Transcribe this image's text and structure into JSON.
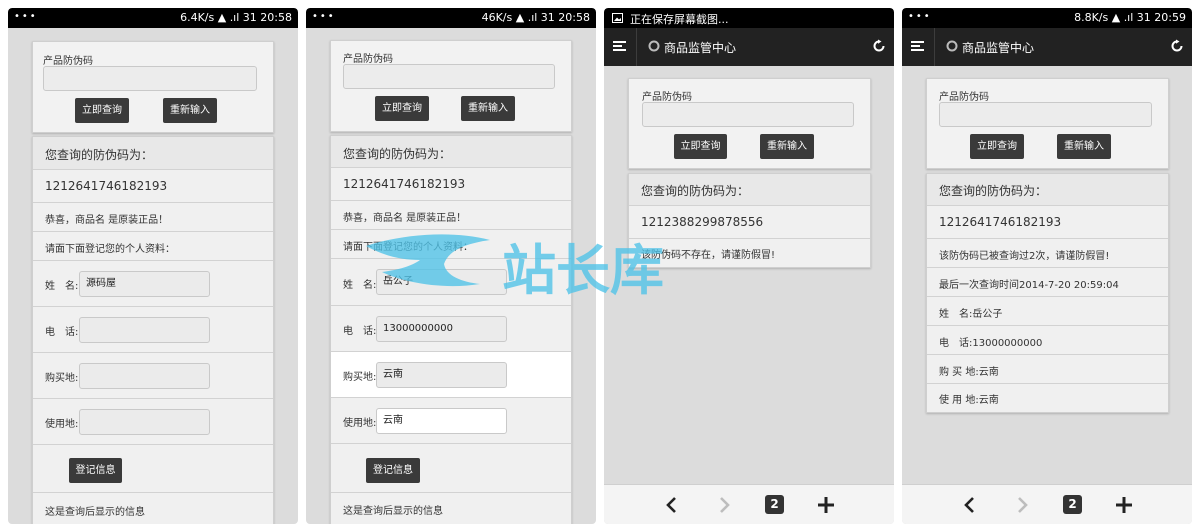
{
  "phones": [
    {
      "status": {
        "left": "•••",
        "right": "6.4K/s ▲ .ıl 31 20:58"
      },
      "form": {
        "label": "产品防伪码",
        "query_button": "立即查询",
        "reset_button": "重新输入"
      },
      "result": {
        "heading": "您查询的防伪码为：",
        "code": "1212641746182193",
        "message": "恭喜，商品名 是原装正品！",
        "prompt": "请面下面登记您的个人资料："
      },
      "fields": [
        {
          "label": "姓　名:",
          "value": "源码屋"
        },
        {
          "label": "电　话:",
          "value": ""
        },
        {
          "label": "购买地:",
          "value": ""
        },
        {
          "label": "使用地:",
          "value": ""
        }
      ],
      "register_button": "登记信息",
      "footer_text": "这是查询后显示的信息"
    },
    {
      "status": {
        "left": "•••",
        "right": "46K/s ▲ .ıl 31 20:58"
      },
      "form": {
        "label": "产品防伪码",
        "query_button": "立即查询",
        "reset_button": "重新输入"
      },
      "result": {
        "heading": "您查询的防伪码为：",
        "code": "1212641746182193",
        "message": "恭喜，商品名 是原装正品！",
        "prompt": "请面下面登记您的个人资料："
      },
      "fields": [
        {
          "label": "姓　名:",
          "value": "岳公子"
        },
        {
          "label": "电　话:",
          "value": "13000000000"
        },
        {
          "label": "购买地:",
          "value": "云南"
        },
        {
          "label": "使用地:",
          "value": "云南"
        }
      ],
      "register_button": "登记信息",
      "footer_text": "这是查询后显示的信息"
    },
    {
      "status": {
        "title": "正在保存屏幕截图..."
      },
      "app_title": "商品监管中心",
      "form": {
        "label": "产品防伪码",
        "query_button": "立即查询",
        "reset_button": "重新输入"
      },
      "result": {
        "heading": "您查询的防伪码为：",
        "code": "1212388299878556",
        "message": "该防伪码不存在，请谨防假冒!"
      },
      "tab_count": "2"
    },
    {
      "status": {
        "left": "•••",
        "right": "8.8K/s ▲ .ıl 31 20:59"
      },
      "app_title": "商品监管中心",
      "form": {
        "label": "产品防伪码",
        "query_button": "立即查询",
        "reset_button": "重新输入"
      },
      "result": {
        "heading": "您查询的防伪码为：",
        "code": "1212641746182193",
        "lines": [
          "该防伪码已被查询过2次，请谨防假冒!",
          "最后一次查询时间2014-7-20 20:59:04",
          "姓　名:岳公子",
          "电　话:13000000000",
          "购 买 地:云南",
          "使 用 地:云南"
        ]
      },
      "tab_count": "2"
    }
  ],
  "watermark": {
    "text": "站长库"
  }
}
